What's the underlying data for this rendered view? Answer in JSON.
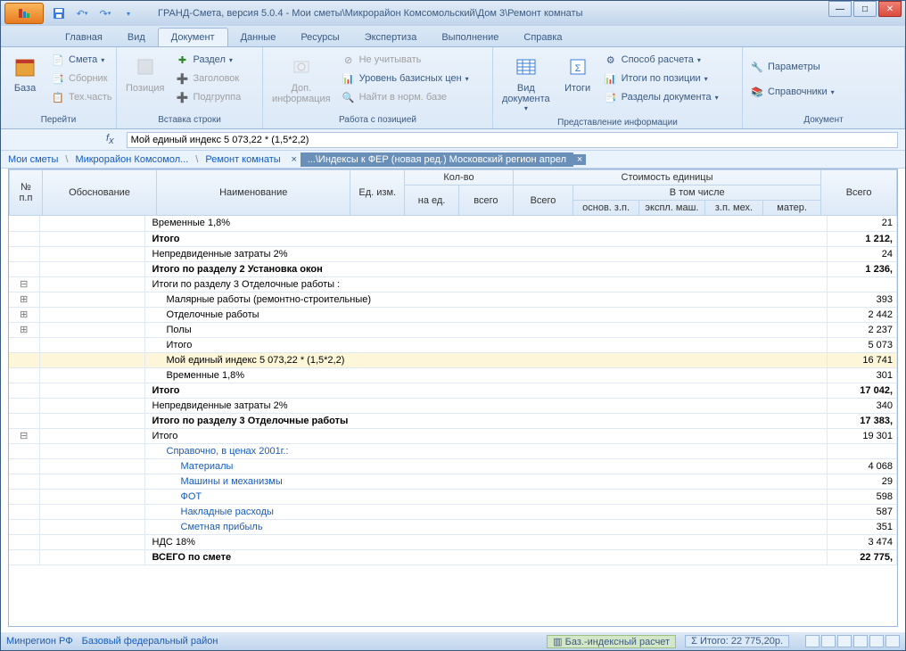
{
  "title": "ГРАНД-Смета, версия 5.0.4 - Мои сметы\\Микрорайон Комсомольский\\Дом 3\\Ремонт комнаты",
  "tabs": [
    "Главная",
    "Вид",
    "Документ",
    "Данные",
    "Ресурсы",
    "Экспертиза",
    "Выполнение",
    "Справка"
  ],
  "activeTab": 2,
  "ribbon": {
    "g0": {
      "label": "Перейти",
      "base": "База",
      "items": [
        "Смета",
        "Сборник",
        "Тех.часть"
      ]
    },
    "g1": {
      "label": "Вставка строки",
      "pos": "Позиция",
      "items": [
        "Раздел",
        "Заголовок",
        "Подгруппа"
      ]
    },
    "g2": {
      "label": "Работа с позицией",
      "dop": "Доп.\nинформация",
      "items": [
        "Не учитывать",
        "Уровень базисных цен",
        "Найти в норм. базе"
      ]
    },
    "g3": {
      "label": "Представление информации",
      "vid": "Вид\nдокумента",
      "itogi": "Итоги",
      "items": [
        "Способ расчета",
        "Итоги по позиции",
        "Разделы документа"
      ]
    },
    "g4": {
      "label": "Документ",
      "items": [
        "Параметры",
        "Справочники"
      ]
    }
  },
  "formula": "Мой единый индекс 5 073,22 * (1,5*2,2)",
  "breadcrumb": [
    "Мои сметы",
    "Микрорайон Комсомол...",
    "Ремонт комнаты"
  ],
  "activeDoc": "...\\Индексы к ФЕР (новая ред.) Московский регион апрел",
  "cols": {
    "num": "№\nп.п",
    "obos": "Обоснование",
    "name": "Наименование",
    "ed": "Ед. изм.",
    "kol": "Кол-во",
    "naed": "на ед.",
    "vsego1": "всего",
    "stoim": "Стоимость единицы",
    "vsego2": "Всего",
    "vtom": "В том числе",
    "osn": "основ. з.п.",
    "eksp": "экспл. маш.",
    "zpmeh": "з.п. мех.",
    "mater": "матер.",
    "total": "Всего"
  },
  "rows": [
    {
      "exp": "",
      "name": "Временные 1,8%",
      "val": "21"
    },
    {
      "exp": "",
      "name": "Итого",
      "val": "1 212,",
      "bold": true
    },
    {
      "exp": "",
      "name": "Непредвиденные затраты 2%",
      "val": "24"
    },
    {
      "exp": "",
      "name": "Итого по разделу 2 Установка окон",
      "val": "1 236,",
      "bold": true
    },
    {
      "exp": "⊟",
      "name": "Итоги по разделу 3 Отделочные работы :",
      "val": "",
      "italic": false
    },
    {
      "exp": "⊞",
      "name": "Малярные работы (ремонтно-строительные)",
      "val": "393",
      "indent": true
    },
    {
      "exp": "⊞",
      "name": "Отделочные работы",
      "val": "2 442",
      "indent": true
    },
    {
      "exp": "⊞",
      "name": "Полы",
      "val": "2 237",
      "indent": true
    },
    {
      "exp": "",
      "name": "Итого",
      "val": "5 073",
      "indent": true
    },
    {
      "exp": "",
      "name": "Мой единый индекс 5 073,22 * (1,5*2,2)",
      "val": "16 741",
      "indent": true,
      "sel": true
    },
    {
      "exp": "",
      "name": "Временные 1,8%",
      "val": "301",
      "indent": true
    },
    {
      "exp": "",
      "name": "Итого",
      "val": "17 042,",
      "bold": true,
      "indent": false
    },
    {
      "exp": "",
      "name": "Непредвиденные затраты 2%",
      "val": "340"
    },
    {
      "exp": "",
      "name": "Итого по разделу 3 Отделочные работы",
      "val": "17 383,",
      "bold": true
    },
    {
      "exp": "⊟",
      "name": "Итого",
      "val": "19 301"
    },
    {
      "exp": "",
      "name": "Справочно, в ценах 2001г.:",
      "val": "",
      "link": true,
      "indent": true
    },
    {
      "exp": "",
      "name": "Материалы",
      "val": "4 068",
      "link": true,
      "indent": true,
      "indent2": true
    },
    {
      "exp": "",
      "name": "Машины и механизмы",
      "val": "29",
      "link": true,
      "indent": true,
      "indent2": true
    },
    {
      "exp": "",
      "name": "ФОТ",
      "val": "598",
      "link": true,
      "indent": true,
      "indent2": true
    },
    {
      "exp": "",
      "name": "Накладные расходы",
      "val": "587",
      "link": true,
      "indent": true,
      "indent2": true
    },
    {
      "exp": "",
      "name": "Сметная прибыль",
      "val": "351",
      "link": true,
      "indent": true,
      "indent2": true
    },
    {
      "exp": "",
      "name": "НДС 18%",
      "val": "3 474"
    },
    {
      "exp": "",
      "name": "ВСЕГО по смете",
      "val": "22 775,",
      "bold": true
    }
  ],
  "status": {
    "region": "Минрегион РФ",
    "base": "Базовый федеральный район",
    "calc": "Баз.-индексный расчет",
    "itogo": "Σ Итого: 22 775,20р."
  }
}
